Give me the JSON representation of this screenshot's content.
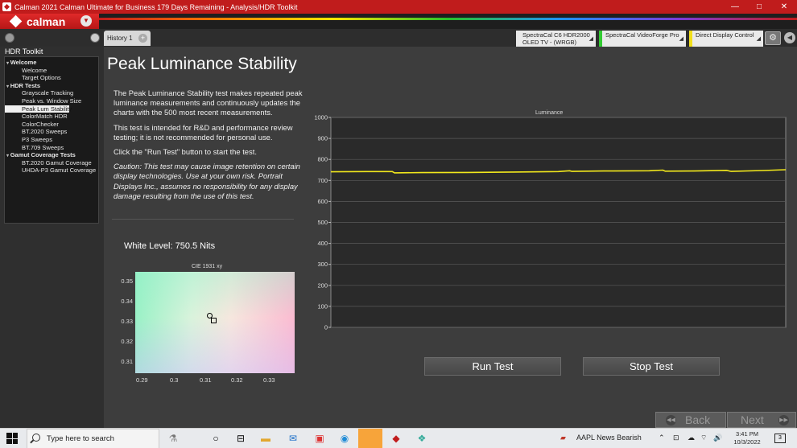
{
  "window": {
    "title": "Calman 2021 Calman Ultimate for Business 179 Days Remaining  - Analysis/HDR Toolkit",
    "controls": [
      "—",
      "□",
      "✕"
    ]
  },
  "brand": {
    "logo_text": "calman"
  },
  "toolbar": {
    "history_tab": "History 1",
    "add_tab": "+",
    "devices": [
      {
        "line1": "SpectraCal C6 HDR2000",
        "line2": "OLED TV - (WRGB)",
        "accent": "#e8e8e8"
      },
      {
        "line1": "SpectraCal VideoForge Pro",
        "line2": "",
        "accent": "#33cc33"
      },
      {
        "line1": "Direct Display Control",
        "line2": "",
        "accent": "#f2e01c"
      }
    ],
    "dropdown_glyph": "◢"
  },
  "sidebar": {
    "title": "HDR Toolkit",
    "tree": [
      {
        "label": "Welcome",
        "kind": "group"
      },
      {
        "label": "Welcome",
        "kind": "leaf"
      },
      {
        "label": "Target Options",
        "kind": "leaf"
      },
      {
        "label": "HDR Tests",
        "kind": "group"
      },
      {
        "label": "Grayscale Tracking",
        "kind": "leaf"
      },
      {
        "label": "Peak vs. Window Size",
        "kind": "leaf"
      },
      {
        "label": "Peak Lum Stability",
        "kind": "leaf",
        "selected": true
      },
      {
        "label": "ColorMatch HDR",
        "kind": "leaf"
      },
      {
        "label": "ColorChecker",
        "kind": "leaf"
      },
      {
        "label": "BT.2020 Sweeps",
        "kind": "leaf"
      },
      {
        "label": "P3 Sweeps",
        "kind": "leaf"
      },
      {
        "label": "BT.709 Sweeps",
        "kind": "leaf"
      },
      {
        "label": "Gamut Coverage Tests",
        "kind": "group"
      },
      {
        "label": "BT.2020 Gamut Coverage",
        "kind": "leaf"
      },
      {
        "label": "UHDA-P3 Gamut Coverage",
        "kind": "leaf"
      }
    ]
  },
  "main": {
    "title": "Peak Luminance Stability",
    "paragraphs": [
      "The Peak Luminance Stability test makes repeated peak luminance measurements and continuously updates the charts with the 500 most recent measurements.",
      "This test is intended for R&D and performance review testing; it is not recommended for personal use.",
      "Click the \"Run Test\" button to start the test."
    ],
    "caution": "Caution: This test may cause image retention on certain display technologies. Use at your own risk. Portrait Displays Inc., assumes no responsibility for any display damage resulting from the use of this test.",
    "white_level": "White Level: 750.5 Nits",
    "run_button": "Run Test",
    "stop_button": "Stop Test",
    "back_button": "Back",
    "next_button": "Next"
  },
  "cie": {
    "title": "CIE 1931 xy",
    "y_ticks": [
      "0.35",
      "0.34",
      "0.33",
      "0.32",
      "0.31"
    ],
    "x_ticks": [
      "0.29",
      "0.3",
      "0.31",
      "0.32",
      "0.33"
    ]
  },
  "chart_data": {
    "type": "line",
    "title": "Luminance",
    "xlabel": "",
    "ylabel": "",
    "ylim": [
      0,
      1000
    ],
    "y_ticks": [
      0,
      100,
      200,
      300,
      400,
      500,
      600,
      700,
      800,
      900,
      1000
    ],
    "grid": true,
    "series": [
      {
        "color": "#f2e81c",
        "x": [
          0,
          8,
          13.5,
          14,
          20,
          30,
          40,
          50,
          52.5,
          53,
          60,
          70,
          73,
          73.5,
          80,
          87,
          88,
          95,
          100
        ],
        "values": [
          741,
          742,
          742,
          736,
          737,
          738,
          740,
          742,
          746,
          743,
          745,
          746,
          749,
          744,
          745,
          748,
          743,
          747,
          751
        ]
      }
    ]
  },
  "taskbar": {
    "search_placeholder": "Type here to search",
    "stock": "AAPL  News Bearish",
    "time": "3:41 PM",
    "date": "10/3/2022",
    "notifications": "3"
  }
}
